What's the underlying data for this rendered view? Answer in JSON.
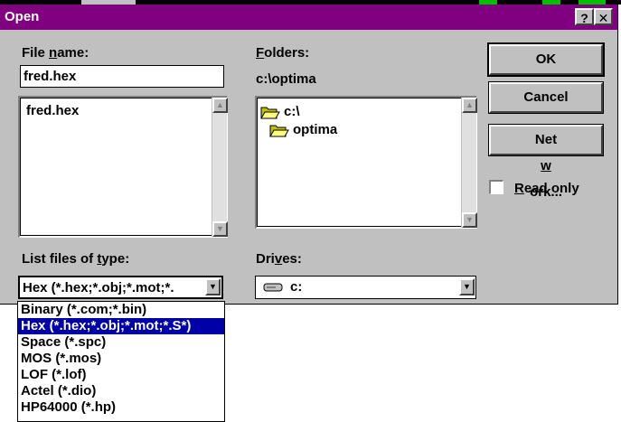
{
  "window": {
    "title": "Open",
    "help_glyph": "?",
    "close_glyph": "✕"
  },
  "file_name": {
    "label_pre": "File ",
    "label_u": "n",
    "label_post": "ame:",
    "value": "fred.hex",
    "items": [
      "fred.hex"
    ]
  },
  "folders": {
    "label_u": "F",
    "label_post": "olders:",
    "path": "c:\\optima",
    "tree": [
      {
        "name": "c:\\",
        "icon": "open-folder-icon"
      },
      {
        "name": "optima",
        "icon": "open-folder-icon"
      }
    ]
  },
  "buttons": {
    "ok": "OK",
    "cancel": "Cancel",
    "network_pre": "Net",
    "network_u": "w",
    "network_post": "ork..."
  },
  "read_only": {
    "label_u": "R",
    "label_post": "ead only",
    "checked": false
  },
  "file_type": {
    "label_pre": "List files of ",
    "label_u": "t",
    "label_post": "ype:",
    "selected": "Hex  (*.hex;*.obj;*.mot;*.",
    "options": [
      {
        "label": "Binary  (*.com;*.bin)",
        "selected": false
      },
      {
        "label": "Hex  (*.hex;*.obj;*.mot;*.S*)",
        "selected": true
      },
      {
        "label": "Space  (*.spc)",
        "selected": false
      },
      {
        "label": "MOS  (*.mos)",
        "selected": false
      },
      {
        "label": "LOF  (*.lof)",
        "selected": false
      },
      {
        "label": "Actel (*.dio)",
        "selected": false
      },
      {
        "label": "HP64000 (*.hp)",
        "selected": false
      }
    ]
  },
  "drives": {
    "label_pre": "Dri",
    "label_u": "v",
    "label_post": "es:",
    "selected": "c:",
    "icon": "drive-icon"
  },
  "colors": {
    "titlebar": "#800080",
    "dialog_face": "#c0c0c0",
    "selection": "#0000a8"
  }
}
